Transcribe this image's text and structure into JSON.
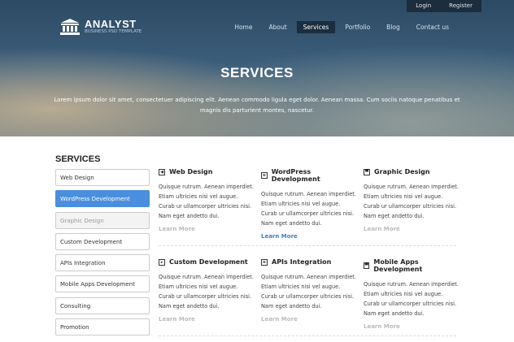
{
  "topbar": {
    "login": "Login",
    "register": "Register"
  },
  "logo": {
    "name": "ANALYST",
    "tagline": "BUSINESS PSD TEMPLATE"
  },
  "nav": [
    {
      "label": "Home"
    },
    {
      "label": "About"
    },
    {
      "label": "Services",
      "active": true
    },
    {
      "label": "Portfolio"
    },
    {
      "label": "Blog"
    },
    {
      "label": "Contact us"
    }
  ],
  "hero": {
    "title": "SERVICES",
    "description": "Lorem ipsum dolor sit amet, consectetuer adipiscing elit. Aenean commodo ligula eget dolor. Aenean massa. Cum sociis natoque penatibus et magnis dis parturient montes, nascetur."
  },
  "sidebar": {
    "title": "SERVICES",
    "items": [
      {
        "label": "Web Design"
      },
      {
        "label": "WordPress Development",
        "state": "active"
      },
      {
        "label": "Graphic Design",
        "state": "muted"
      },
      {
        "label": "Custom Development"
      },
      {
        "label": "APIs Integration"
      },
      {
        "label": "Mobile Apps Development"
      },
      {
        "label": "Consulting"
      },
      {
        "label": "Promotion"
      }
    ]
  },
  "cards": [
    {
      "title": "Web Design",
      "icon": "megaphone-icon",
      "text": "Quisque rutrum. Aenean imperdiet. Etiam ultricies nisi vel augue. Curab ur ullamcorper ultricies nisi. Nam eget andetto dui.",
      "link": "Learn More"
    },
    {
      "title": "WordPress Development",
      "icon": "document-icon",
      "text": "Quisque rutrum. Aenean imperdiet. Etiam ultricies nisi vel augue. Curab ur ullamcorper ultricies nisi. Nam eget andetto dui.",
      "link": "Learn More"
    },
    {
      "title": "Graphic Design",
      "icon": "shop-icon",
      "text": "Quisque rutrum. Aenean imperdiet. Etiam ultricies nisi vel augue. Curab ur ullamcorper ultricies nisi. Nam eget andetto dui.",
      "link": "Learn More"
    },
    {
      "title": "Custom Development",
      "icon": "play-box-icon",
      "text": "Quisque rutrum. Aenean imperdiet. Etiam ultricies nisi vel augue. Curab ur ullamcorper ultricies nisi. Nam eget andetto dui.",
      "link": "Learn More"
    },
    {
      "title": "APIs Integration",
      "icon": "document-icon",
      "text": "Quisque rutrum. Aenean imperdiet. Etiam ultricies nisi vel augue. Curab ur ullamcorper ultricies nisi. Nam eget andetto dui.",
      "link": "Learn More"
    },
    {
      "title": "Mobile Apps Development",
      "icon": "shop-icon",
      "text": "Quisque rutrum. Aenean imperdiet. Etiam ultricies nisi vel augue. Curab ur ullamcorper ultricies nisi. Nam eget andetto dui.",
      "link": "Learn More"
    }
  ],
  "colors": {
    "accent": "#4a8fde",
    "link": "#3a7fc9"
  }
}
